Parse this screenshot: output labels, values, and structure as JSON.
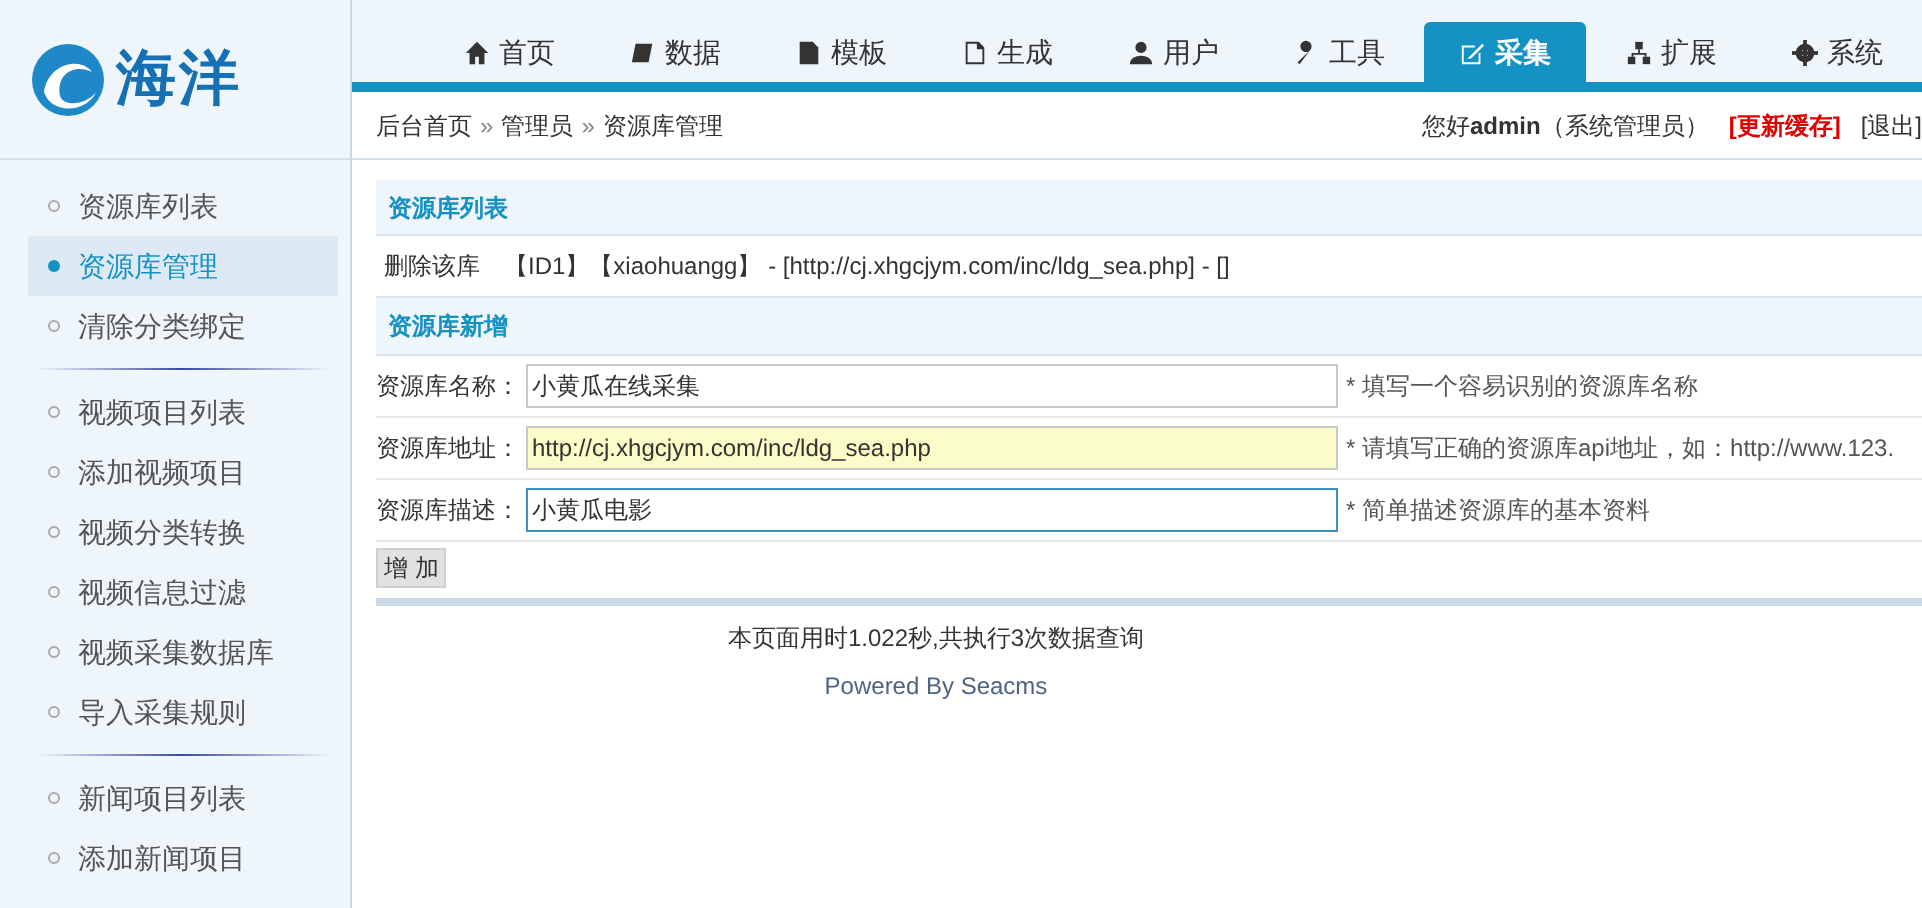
{
  "logo": {
    "text": "海洋"
  },
  "tabs": [
    {
      "label": "首页",
      "selected": false
    },
    {
      "label": "数据",
      "selected": false
    },
    {
      "label": "模板",
      "selected": false
    },
    {
      "label": "生成",
      "selected": false
    },
    {
      "label": "用户",
      "selected": false
    },
    {
      "label": "工具",
      "selected": false
    },
    {
      "label": "采集",
      "selected": true
    },
    {
      "label": "扩展",
      "selected": false
    },
    {
      "label": "系统",
      "selected": false
    }
  ],
  "breadcrumb": [
    "后台首页",
    "»",
    "管理员",
    "»",
    "资源库管理"
  ],
  "user_bar": {
    "greeting": "您好",
    "username": "admin",
    "role": "（系统管理员）",
    "refresh_cache": "[更新缓存]",
    "logout": "[退出]"
  },
  "sidebar": {
    "groups": [
      {
        "items": [
          {
            "label": "资源库列表",
            "selected": false
          },
          {
            "label": "资源库管理",
            "selected": true
          },
          {
            "label": "清除分类绑定",
            "selected": false
          }
        ]
      },
      {
        "items": [
          {
            "label": "视频项目列表",
            "selected": false
          },
          {
            "label": "添加视频项目",
            "selected": false
          },
          {
            "label": "视频分类转换",
            "selected": false
          },
          {
            "label": "视频信息过滤",
            "selected": false
          },
          {
            "label": "视频采集数据库",
            "selected": false
          },
          {
            "label": "导入采集规则",
            "selected": false
          }
        ]
      },
      {
        "items": [
          {
            "label": "新闻项目列表",
            "selected": false
          },
          {
            "label": "添加新闻项目",
            "selected": false
          }
        ]
      }
    ]
  },
  "list_section": {
    "title": "资源库列表",
    "row": {
      "delete_link": "删除该库",
      "text": "【ID1】【xiaohuangg】 - [http://cj.xhgcjym.com/inc/ldg_sea.php] - []"
    }
  },
  "add_section": {
    "title": "资源库新增",
    "fields": [
      {
        "label": "资源库名称：",
        "value": "小黄瓜在线采集",
        "hint": "* 填写一个容易识别的资源库名称",
        "autofilled": false,
        "focused": false
      },
      {
        "label": "资源库地址：",
        "value": "http://cj.xhgcjym.com/inc/ldg_sea.php",
        "hint": "* 请填写正确的资源库api地址，如：http://www.123.",
        "autofilled": true,
        "focused": false
      },
      {
        "label": "资源库描述：",
        "value": "小黄瓜电影",
        "hint": "* 简单描述资源库的基本资料",
        "autofilled": false,
        "focused": true
      }
    ],
    "submit": "增 加"
  },
  "footer": {
    "timing": "本页面用时1.022秒,共执行3次数据查询",
    "powered": "Powered By Seacms"
  }
}
